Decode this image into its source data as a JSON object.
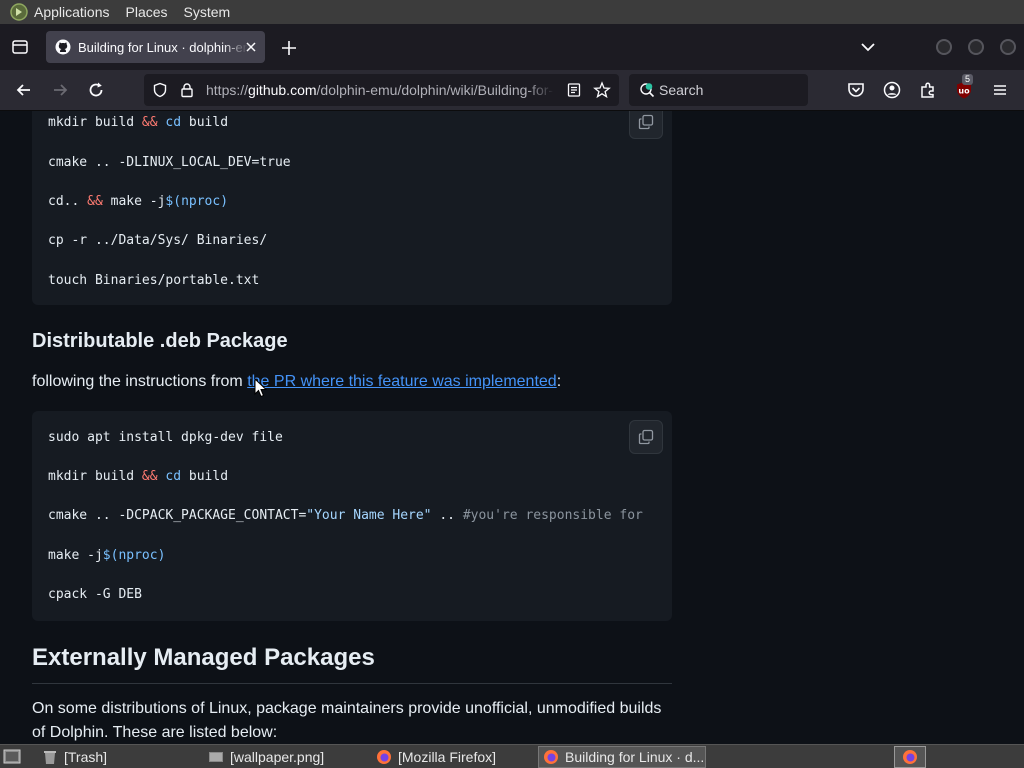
{
  "top_panel": {
    "menus": [
      "Applications",
      "Places",
      "System"
    ]
  },
  "browser": {
    "tab": {
      "title": "Building for Linux · dolphin-emu/dolphin Wiki"
    },
    "url": {
      "prefix": "https://",
      "host": "github.com",
      "path": "/dolphin-emu/dolphin/wiki/Building-for-Linux"
    },
    "search_placeholder": "Search",
    "extension_badge": "5"
  },
  "page": {
    "code_block_1": {
      "lines": [
        [
          "mkdir build ",
          "&&",
          " cd",
          " build"
        ],
        [
          "cmake .. -DLINUX_LOCAL_DEV=true"
        ],
        [
          "cd.. ",
          "&&",
          " make -j",
          "$(nproc)"
        ],
        [
          "cp -r ../Data/Sys/ Binaries/"
        ],
        [
          "touch Binaries/portable.txt"
        ]
      ]
    },
    "heading_deb": "Distributable .deb Package",
    "para_deb_prefix": "following the instructions from ",
    "para_deb_link": "the PR where this feature was implemented",
    "para_deb_suffix": ":",
    "code_block_2": {
      "line1": "sudo apt install dpkg-dev file",
      "line2_a": "mkdir build ",
      "line2_op": "&&",
      "line2_cd": " cd",
      "line2_b": " build",
      "line3_a": "cmake .. -DCPACK_PACKAGE_CONTACT=",
      "line3_str": "\"Your Name Here\"",
      "line3_b": " .. ",
      "line3_comment": "#you're responsible for",
      "line4_a": "make -j",
      "line4_b": "$(nproc)",
      "line5": "cpack -G DEB"
    },
    "heading_external": "Externally Managed Packages",
    "para_external": "On some distributions of Linux, package maintainers provide unofficial, unmodified builds of Dolphin. These are listed below:"
  },
  "taskbar": {
    "items": [
      "[Trash]",
      "[wallpaper.png]",
      "[Mozilla Firefox]",
      "Building for Linux · d..."
    ]
  },
  "colors": {
    "accent_link": "#4493f8",
    "page_bg": "#0d1117",
    "code_bg": "#161b22"
  }
}
